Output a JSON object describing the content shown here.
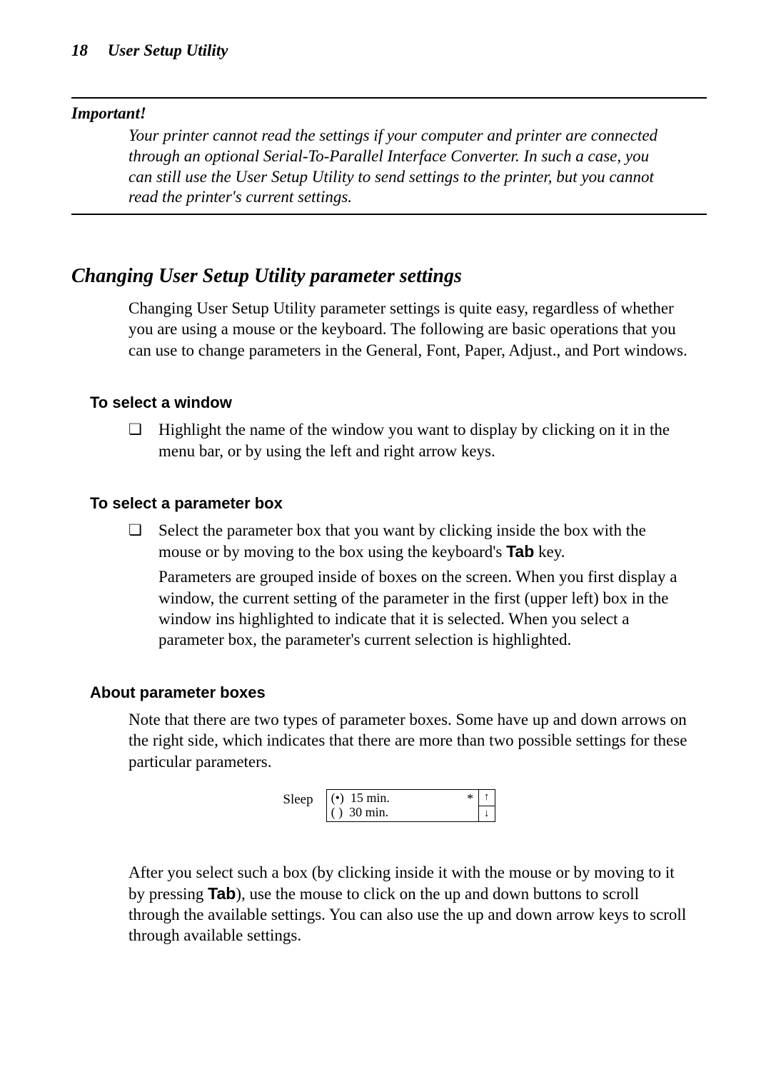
{
  "header": {
    "page_number": "18",
    "title": "User Setup Utility"
  },
  "important": {
    "label": "Important!",
    "text": "Your printer cannot read the settings if your computer and printer are connected through an optional Serial-To-Parallel Interface Converter. In such a case, you can still use the User Setup Utility to send settings to the printer, but you cannot read the printer's current settings."
  },
  "section": {
    "title": "Changing User Setup Utility parameter settings",
    "intro": "Changing User Setup Utility parameter settings is quite easy, regardless of whether you are using a mouse or the keyboard. The following are basic operations that you can use to change parameters in the General, Font, Paper, Adjust., and Port windows."
  },
  "select_window": {
    "heading": "To select a window",
    "item": "Highlight the name of the window you want to display by clicking on it in the menu bar, or by using the left and right arrow keys."
  },
  "select_param": {
    "heading": "To select a parameter box",
    "item_pre": "Select the parameter box that you want by clicking inside the box with the mouse or by moving to the box using the keyboard's ",
    "tab_word": "Tab",
    "item_post": " key.",
    "para2": "Parameters are grouped inside of boxes on the screen. When you first display a window, the current setting of the parameter in the first (upper left) box in the window ins highlighted to indicate that it is selected. When you select a parameter box, the parameter's current selection is highlighted."
  },
  "about_boxes": {
    "heading": "About parameter boxes",
    "para1": "Note that there are two types of parameter boxes. Some have up and down arrows on the right side, which indicates that there are more than two possible settings for these particular parameters.",
    "figure": {
      "label": "Sleep",
      "option1_marker": "(•)",
      "option1_text": "15 min.",
      "option2_marker": "( )",
      "option2_text": "30 min.",
      "asterisk": "*",
      "arrow_up": "↑",
      "arrow_down": "↓"
    },
    "para2_pre": "After you select such a box (by clicking inside it with the mouse or by moving to it by pressing ",
    "tab_word": "Tab",
    "para2_post": "), use the mouse to click on the up and down buttons to scroll through the available settings. You can also use the up and down arrow keys to scroll through available settings."
  }
}
